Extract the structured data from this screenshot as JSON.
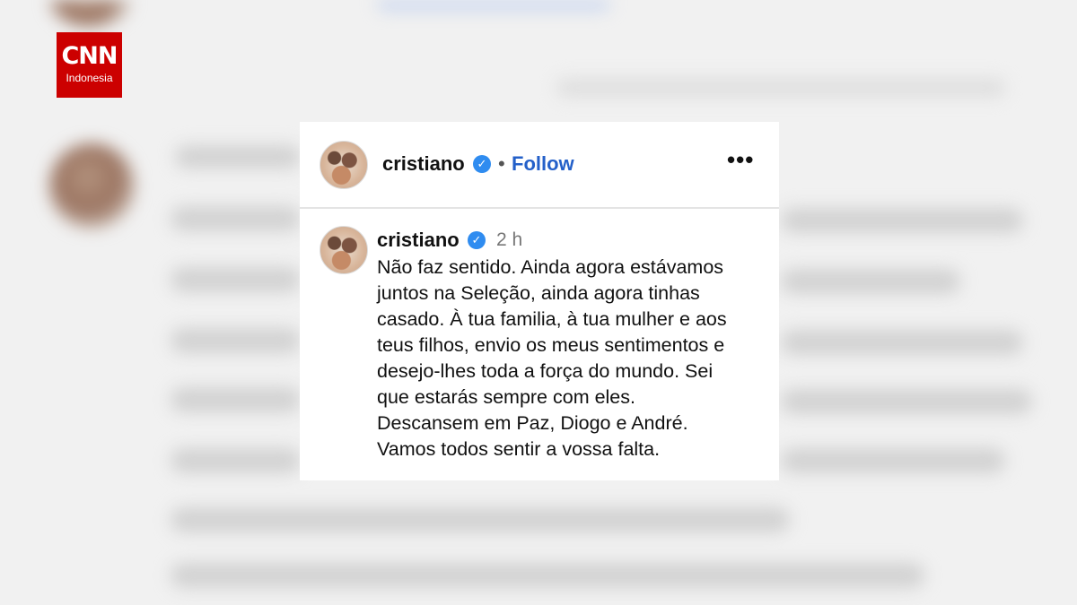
{
  "brand": {
    "logo_word": "CNN",
    "logo_sub": "Indonesia",
    "color": "#cc0000"
  },
  "post": {
    "username": "cristiano",
    "verified_icon": "verified-badge-icon",
    "follow_label": "Follow",
    "separator": "•",
    "more_icon": "•••"
  },
  "comment": {
    "username": "cristiano",
    "time": "2 h",
    "lines": [
      "Não faz sentido. Ainda agora estávamos",
      "juntos na Seleção, ainda agora tinhas",
      "casado. À tua familia, à tua mulher e aos",
      "teus filhos, envio os meus sentimentos e",
      "desejo-lhes toda a força do mundo. Sei",
      "que estarás sempre com eles.",
      "Descansem em Paz, Diogo e André.",
      "Vamos todos sentir a vossa falta."
    ]
  },
  "colors": {
    "verified": "#2f8cf0",
    "follow": "#2460c9",
    "background": "#f1f1f1"
  }
}
